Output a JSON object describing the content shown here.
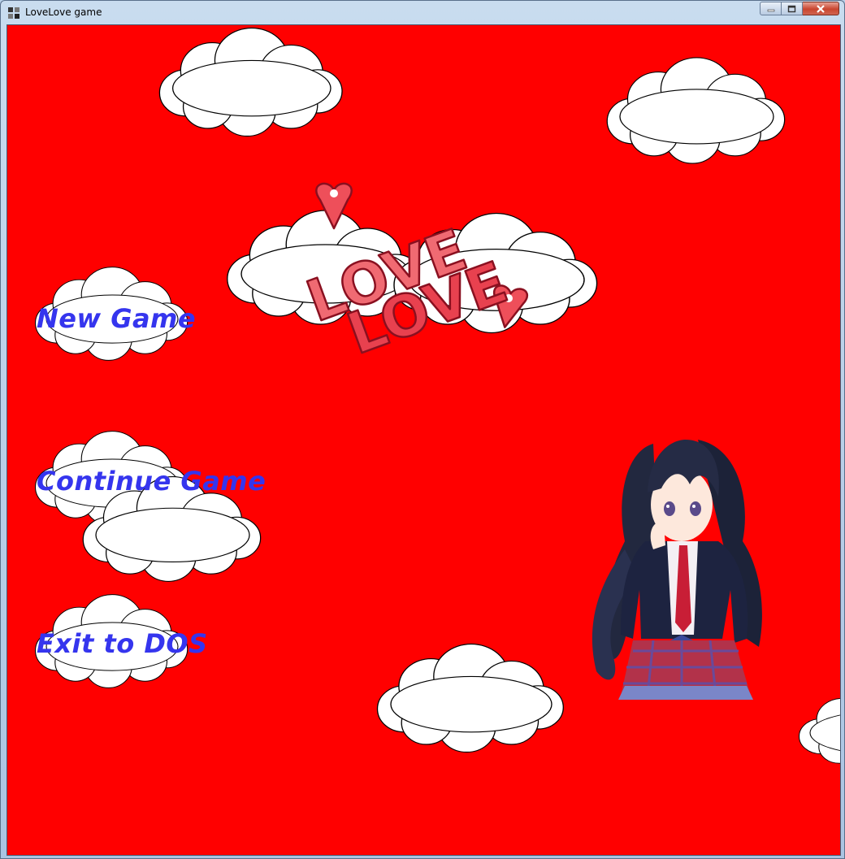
{
  "window": {
    "title": "LoveLove game",
    "icon": "app-icon"
  },
  "controls": {
    "minimize": "minimize-icon",
    "maximize": "maximize-icon",
    "close": "close-icon"
  },
  "logo": {
    "line1": "LOVE",
    "line2": "LOVE"
  },
  "menu": {
    "new_game": "New Game",
    "continue_game": "Continue Game",
    "exit": "Exit to DOS"
  },
  "colors": {
    "background": "#ff0000",
    "menu_text": "#3535ee",
    "logo_fill": "#ee4f5a",
    "cloud": "#ffffff"
  }
}
